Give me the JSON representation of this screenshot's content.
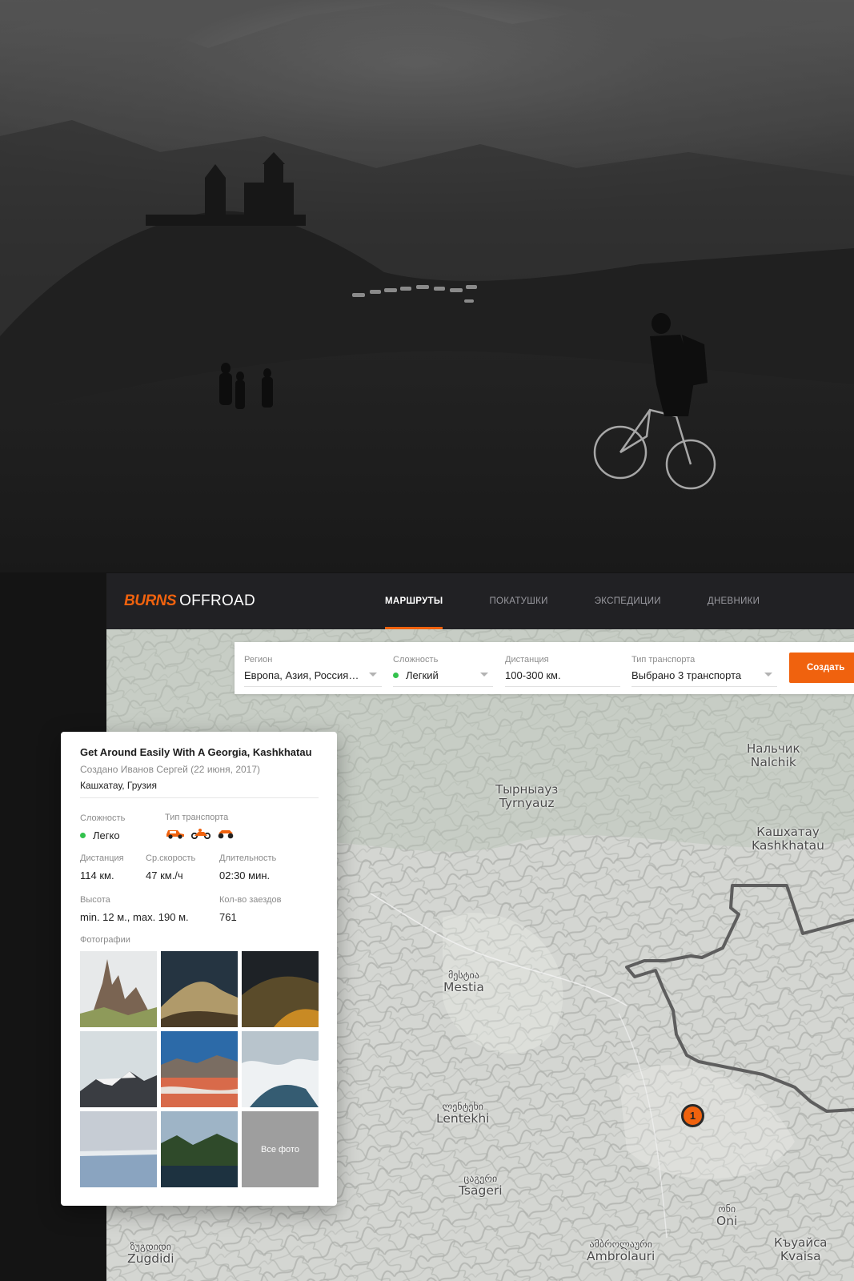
{
  "brand": {
    "logo_mark": "BURNS",
    "logo_text": "OFFROAD",
    "accent": "#f0620e"
  },
  "nav": {
    "items": [
      {
        "label": "МАРШРУТЫ",
        "active": true
      },
      {
        "label": "ПОКАТУШКИ",
        "active": false
      },
      {
        "label": "ЭКСПЕДИЦИИ",
        "active": false
      },
      {
        "label": "ДНЕВНИКИ",
        "active": false
      }
    ]
  },
  "filters": {
    "region": {
      "label": "Регион",
      "value": "Европа, Азия, Россия…"
    },
    "difficulty": {
      "label": "Сложность",
      "value": "Легкий",
      "dot_color": "#33c24d"
    },
    "distance": {
      "label": "Дистанция",
      "value": "100-300 км."
    },
    "transport": {
      "label": "Тип транспорта",
      "value": "Выбрано 3 транспорта"
    },
    "create_label": "Создать"
  },
  "map": {
    "cities": [
      {
        "local": "Нальчик",
        "latin": "Nalchik"
      },
      {
        "local": "Тырныауз",
        "latin": "Tyrnyauz"
      },
      {
        "local": "Кашхатау",
        "latin": "Kashkhatau"
      },
      {
        "local": "მესტია",
        "latin": "Mestia"
      },
      {
        "local": "ლენტეხი",
        "latin": "Lentekhi"
      },
      {
        "local": "ცაგერი",
        "latin": "Tsageri"
      },
      {
        "local": "ონი",
        "latin": "Oni"
      },
      {
        "local": "ამბროლაური",
        "latin": "Ambrolauri"
      },
      {
        "local": "Къуайса",
        "latin": "Kvaisa"
      },
      {
        "local": "ზუგდიდი",
        "latin": "Zugdidi"
      }
    ],
    "marker_label": "1"
  },
  "card": {
    "title": "Get Around Easily With A Georgia, Kashkhatau",
    "author": "Создано Иванов Сергей (22 июня, 2017)",
    "place": "Кашхатау, Грузия",
    "difficulty": {
      "label": "Сложность",
      "value": "Легко"
    },
    "transport": {
      "label": "Тип транспорта",
      "icons": [
        "jeep-icon",
        "motorcycle-icon",
        "atv-icon"
      ]
    },
    "distance": {
      "label": "Дистанция",
      "value": "114 км."
    },
    "avg_speed": {
      "label": "Ср.скорость",
      "value": "47 км./ч"
    },
    "duration": {
      "label": "Длительность",
      "value": "02:30 мин."
    },
    "altitude": {
      "label": "Высота",
      "value": "min. 12 м., max. 190 м."
    },
    "rides": {
      "label": "Кол-во заездов",
      "value": "761"
    },
    "photos_label": "Фотографии",
    "all_photos_label": "Все фото"
  }
}
